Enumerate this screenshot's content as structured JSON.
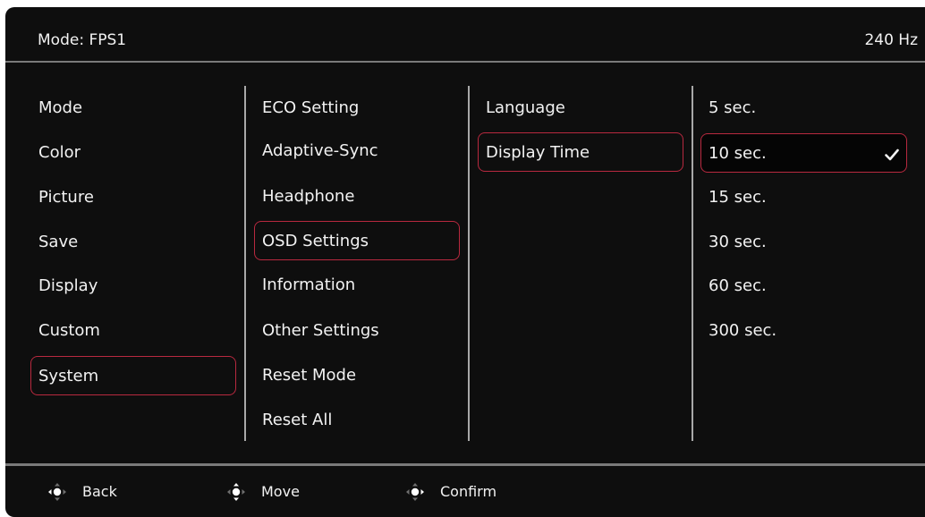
{
  "header": {
    "mode_label": "Mode: FPS1",
    "refresh_rate": "240 Hz"
  },
  "columns": {
    "main_menu": [
      "Mode",
      "Color",
      "Picture",
      "Save",
      "Display",
      "Custom",
      "System"
    ],
    "system_menu": [
      "ECO Setting",
      "Adaptive-Sync",
      "Headphone",
      "OSD Settings",
      "Information",
      "Other Settings",
      "Reset Mode",
      "Reset All"
    ],
    "osd_menu": [
      "Language",
      "Display Time"
    ],
    "display_time_options": [
      "5 sec.",
      "10 sec.",
      "15 sec.",
      "30 sec.",
      "60 sec.",
      "300 sec."
    ]
  },
  "selection": {
    "main_menu": "System",
    "system_menu": "OSD Settings",
    "osd_menu": "Display Time",
    "display_time_checked": "10 sec."
  },
  "footer": {
    "back": "Back",
    "move": "Move",
    "confirm": "Confirm"
  },
  "icons": {
    "check": "check-icon",
    "back": "dpad-left-icon",
    "move": "dpad-updown-icon",
    "confirm": "dpad-right-icon"
  },
  "colors": {
    "background": "#0e0e0e",
    "text": "#f2f2f2",
    "selection_border": "#b8293f",
    "divider": "#a8a8a8"
  }
}
